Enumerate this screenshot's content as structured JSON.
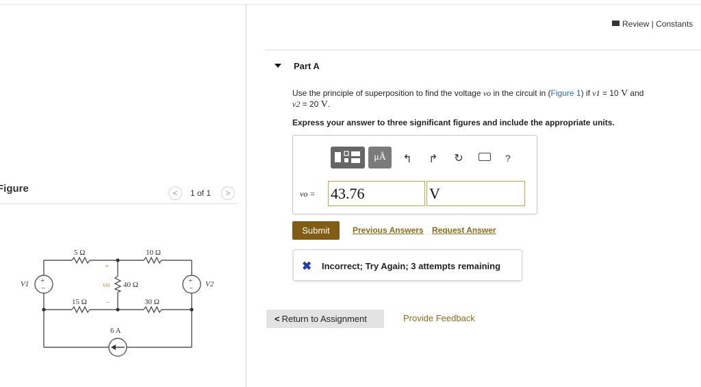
{
  "left_pane": {
    "figure_label": "Figure",
    "pagination": "1 of 1",
    "prev_icon": "chevron-left-icon",
    "next_icon": "chevron-right-icon"
  },
  "circuit": {
    "r1": "5 Ω",
    "r2": "10 Ω",
    "r3": "40 Ω",
    "r4": "15 Ω",
    "r5": "30 Ω",
    "source_left": "V1",
    "source_right": "V2",
    "current_source": "6 A",
    "vo_label": "vo",
    "plus": "+",
    "minus": "−"
  },
  "header": {
    "review_constants": "Review | Constants"
  },
  "part": {
    "title": "Part A",
    "question_line1_prefix": "Use the principle of superposition to find the voltage ",
    "vo_symbol": "vo",
    "question_line1_mid": " in the circuit in (",
    "figure_link": "Figure 1",
    "question_line1_tail": ") if ",
    "v1_symbol": "v1",
    "v1_value": " = 10 ",
    "v_unit": "V",
    "and_text": " and",
    "v2_symbol": "v2",
    "v2_value": " = 20 ",
    "period": ".",
    "instruction": "Express your answer to three significant figures and include the appropriate units."
  },
  "answer": {
    "unit_button": "μÅ",
    "help": "?",
    "vo_label": "vo =",
    "value": "43.76",
    "unit": "V"
  },
  "actions": {
    "submit": "Submit",
    "previous_answers": "Previous Answers",
    "request_answer": "Request Answer"
  },
  "feedback": {
    "icon": "x-icon",
    "message": "Incorrect; Try Again; 3 attempts remaining"
  },
  "footer": {
    "return": "Return to Assignment",
    "provide_feedback": "Provide Feedback"
  },
  "colors": {
    "submit_bg": "#835c13",
    "link_gold": "#8b6a1a",
    "input_border": "#c7a445",
    "x_icon": "#1f3fb0"
  }
}
